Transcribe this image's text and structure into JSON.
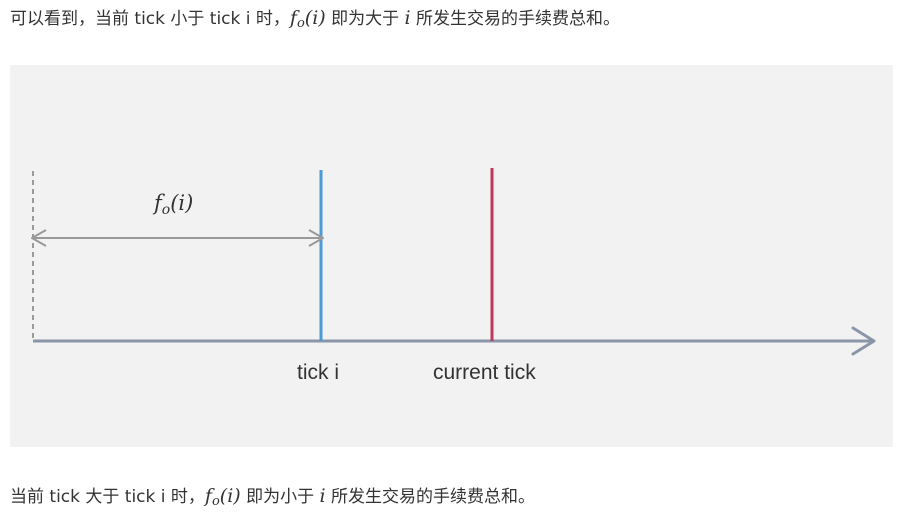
{
  "para1": {
    "before": "可以看到，当前 tick 小于 tick i 时，",
    "f": "f",
    "sub": "o",
    "arg": "(i)",
    "middle": " 即为大于 ",
    "var": "i",
    "after": " 所发生交易的手续费总和。"
  },
  "figure": {
    "distance_label": {
      "f": "f",
      "sub": "o",
      "arg": "(i)"
    },
    "tick_i_label": "tick i",
    "current_tick_label": "current tick",
    "colors": {
      "background": "#f2f2f2",
      "axis": "#8a96a8",
      "tick_i_line": "#4a9bd6",
      "current_tick_line": "#c0395a",
      "measure_arrow": "#999999"
    }
  },
  "para2": {
    "before": "当前 tick 大于 tick i 时，",
    "f": "f",
    "sub": "o",
    "arg": "(i)",
    "middle": " 即为小于 ",
    "var": "i",
    "after": " 所发生交易的手续费总和。"
  }
}
